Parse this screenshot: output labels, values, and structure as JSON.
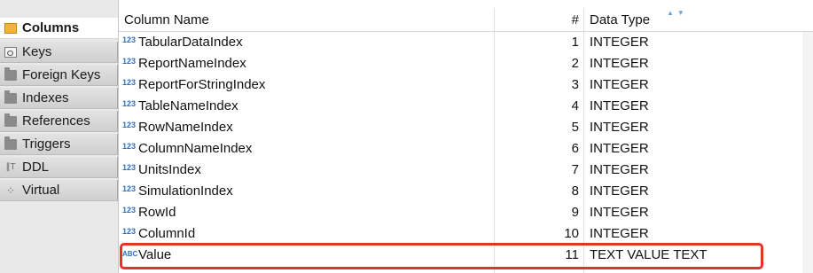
{
  "tabs": [
    {
      "label": "Columns",
      "icon": "columns-icon",
      "active": true
    },
    {
      "label": "Keys",
      "icon": "key-icon",
      "active": false
    },
    {
      "label": "Foreign Keys",
      "icon": "folder-icon",
      "active": false
    },
    {
      "label": "Indexes",
      "icon": "folder-icon",
      "active": false
    },
    {
      "label": "References",
      "icon": "folder-icon",
      "active": false
    },
    {
      "label": "Triggers",
      "icon": "folder-icon",
      "active": false
    },
    {
      "label": "DDL",
      "icon": "ddl-icon",
      "active": false
    },
    {
      "label": "Virtual",
      "icon": "virtual-icon",
      "active": false
    }
  ],
  "grid": {
    "headers": {
      "name": "Column Name",
      "num": "#",
      "type": "Data Type"
    },
    "rows": [
      {
        "type_icon": "123",
        "name": "TabularDataIndex",
        "num": "1",
        "type": "INTEGER"
      },
      {
        "type_icon": "123",
        "name": "ReportNameIndex",
        "num": "2",
        "type": "INTEGER"
      },
      {
        "type_icon": "123",
        "name": "ReportForStringIndex",
        "num": "3",
        "type": "INTEGER"
      },
      {
        "type_icon": "123",
        "name": "TableNameIndex",
        "num": "4",
        "type": "INTEGER"
      },
      {
        "type_icon": "123",
        "name": "RowNameIndex",
        "num": "5",
        "type": "INTEGER"
      },
      {
        "type_icon": "123",
        "name": "ColumnNameIndex",
        "num": "6",
        "type": "INTEGER"
      },
      {
        "type_icon": "123",
        "name": "UnitsIndex",
        "num": "7",
        "type": "INTEGER"
      },
      {
        "type_icon": "123",
        "name": "SimulationIndex",
        "num": "8",
        "type": "INTEGER"
      },
      {
        "type_icon": "123",
        "name": "RowId",
        "num": "9",
        "type": "INTEGER"
      },
      {
        "type_icon": "123",
        "name": "ColumnId",
        "num": "10",
        "type": "INTEGER"
      },
      {
        "type_icon": "ABC",
        "name": "Value",
        "num": "11",
        "type": "TEXT VALUE TEXT"
      }
    ]
  },
  "colors": {
    "highlight": "#e8312c",
    "type_icon": "#2f6fc0"
  }
}
